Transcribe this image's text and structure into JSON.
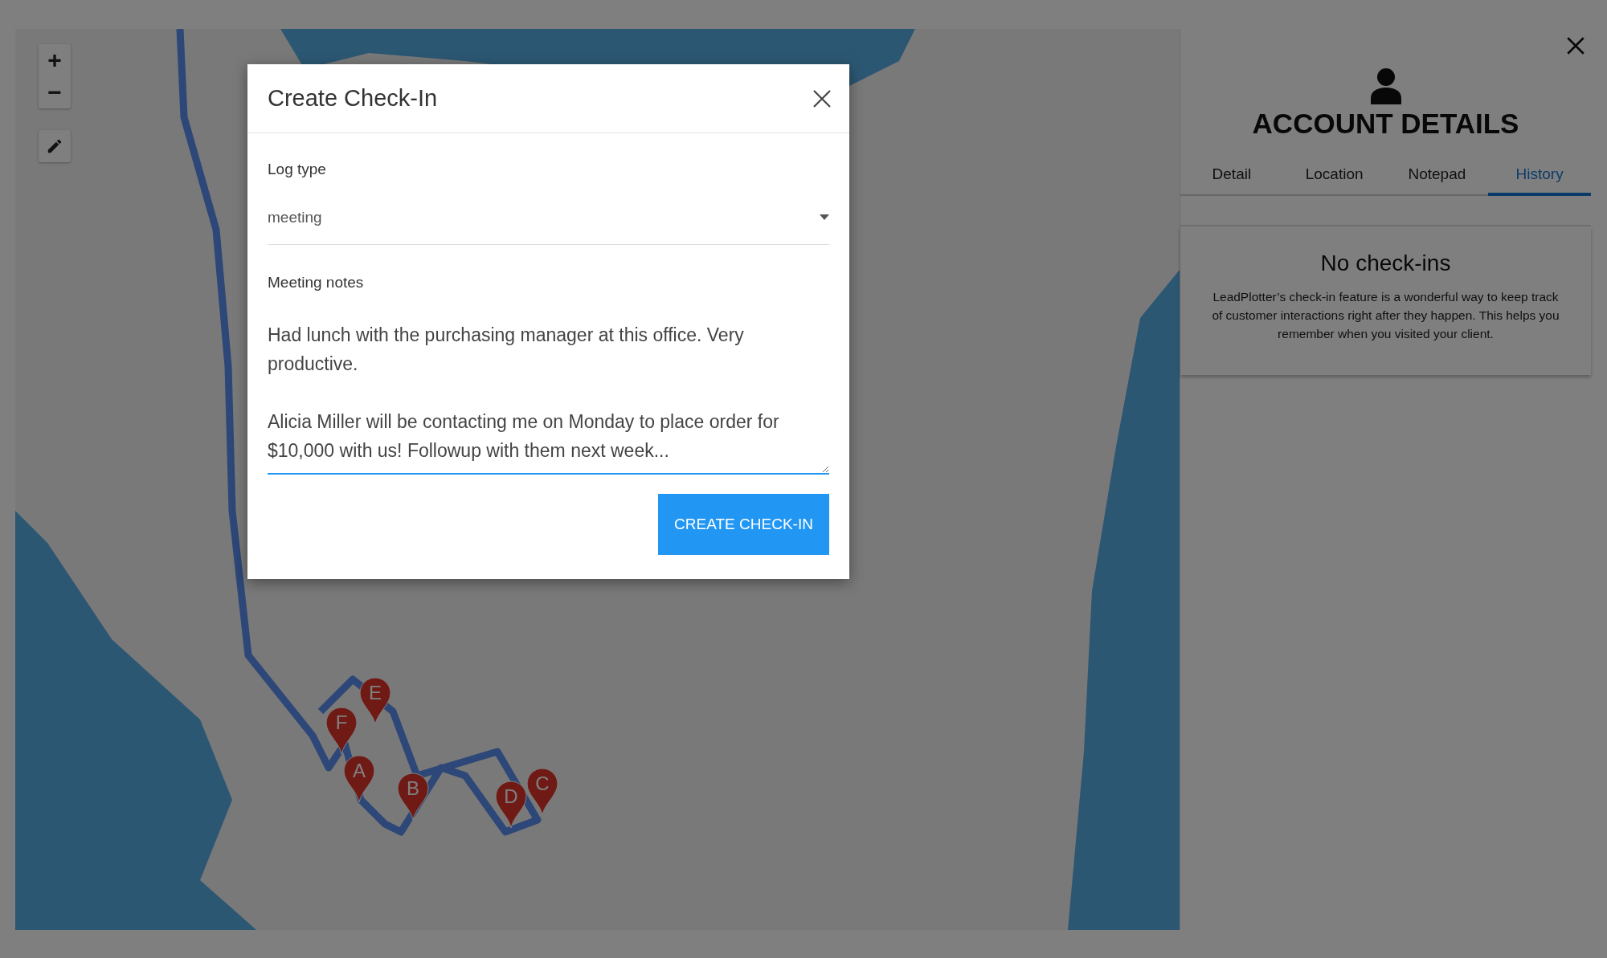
{
  "map": {
    "zoom_controls": [
      {
        "label": "+"
      },
      {
        "label": "−"
      }
    ],
    "markers": [
      {
        "label": "E"
      },
      {
        "label": "F"
      },
      {
        "label": "A"
      },
      {
        "label": "B"
      },
      {
        "label": "D"
      },
      {
        "label": "C"
      }
    ]
  },
  "account_panel": {
    "title": "ACCOUNT DETAILS",
    "tabs": [
      {
        "label": "Detail",
        "selected": false
      },
      {
        "label": "Location",
        "selected": false
      },
      {
        "label": "Notepad",
        "selected": false
      },
      {
        "label": "History",
        "selected": true
      }
    ],
    "empty_state": {
      "heading": "No check-ins",
      "text": "LeadPlotter’s check-in feature is a wonderful way to keep track of customer interactions right after they happen. This helps you remember when you visited your client."
    }
  },
  "dialog": {
    "title": "Create Check-In",
    "log_type": {
      "label": "Log type",
      "value": "meeting"
    },
    "notes": {
      "label": "Meeting notes",
      "value": "Had lunch with the purchasing manager at this office. Very productive.\n\nAlicia Miller will be contacting me on Monday to place order for $10,000 with us! Followup with them next week..."
    },
    "submit_button": "CREATE CHECK-IN"
  }
}
